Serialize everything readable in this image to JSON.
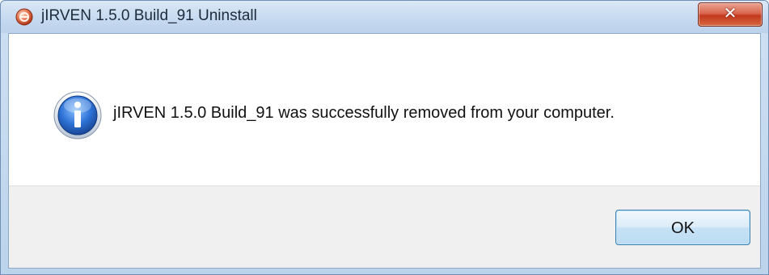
{
  "window": {
    "title": "jIRVEN 1.5.0 Build_91 Uninstall",
    "app_icon": "installer-app-icon",
    "close_icon": "close-icon",
    "close_glyph": "✕"
  },
  "dialog": {
    "icon": "info-icon",
    "message": "jIRVEN 1.5.0 Build_91 was successfully removed from your computer.",
    "ok_label": "OK"
  },
  "colors": {
    "titlebar": "#c6daf0",
    "close_button": "#c3381e",
    "info_icon": "#1e5bb8",
    "button_area": "#f0f0f0",
    "ok_border": "#3c7fb1"
  }
}
